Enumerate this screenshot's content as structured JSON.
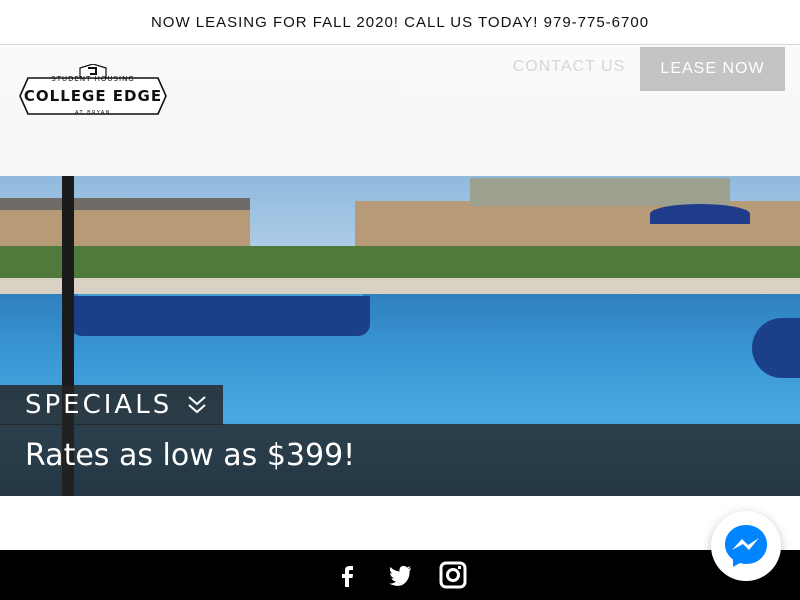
{
  "announcement": {
    "text": "NOW LEASING FOR FALL 2020! CALL US TODAY! 979-775-6700"
  },
  "logo": {
    "top_text": "STUDENT    HOUSING",
    "main_text": "COLLEGE EDGE",
    "bottom_text": "AT BRYAN"
  },
  "nav": {
    "contact_label": "CONTACT US",
    "lease_label": "LEASE NOW"
  },
  "specials": {
    "label": "SPECIALS",
    "message": "Rates as low as $399!",
    "chevron_icon": "double-chevron-down-icon"
  },
  "footer": {
    "icons": [
      "facebook-icon",
      "twitter-icon",
      "instagram-icon"
    ]
  },
  "chat": {
    "icon": "messenger-icon",
    "color": "#0084ff"
  },
  "colors": {
    "lease_button": "#c4c4c4",
    "contact_link": "#d6d6d6",
    "overlay": "#232323"
  }
}
